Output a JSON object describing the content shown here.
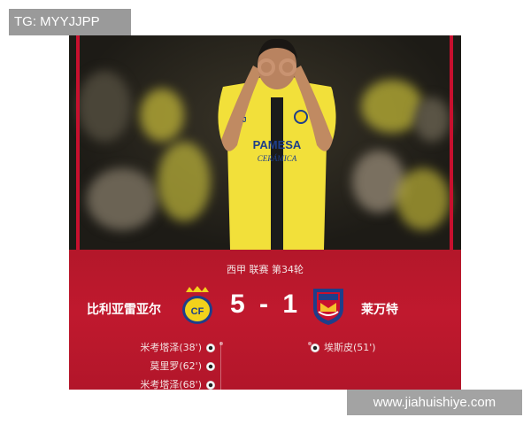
{
  "overlay": {
    "tg_label": "TG: MYYJJPP",
    "watermark": "www.jiahuishiye.com"
  },
  "match": {
    "competition": "西甲 联赛 第34轮",
    "home_team": "比利亚雷亚尔",
    "away_team": "莱万特",
    "score": "5 - 1",
    "home_scorers": [
      {
        "name": "米考塔泽(38')"
      },
      {
        "name": "莫里罗(62')"
      },
      {
        "name": "米考塔泽(68')"
      }
    ],
    "away_scorers": [
      {
        "name": "埃斯皮(51')"
      }
    ]
  },
  "jersey": {
    "sponsor": "PAMESA",
    "sponsor_sub": "CERÁMICA"
  },
  "colors": {
    "panel_red": "#b3172a",
    "jersey_yellow": "#f2e03a",
    "home_crest_yellow": "#f2d21b",
    "away_crest_blue": "#1e3e8a"
  }
}
